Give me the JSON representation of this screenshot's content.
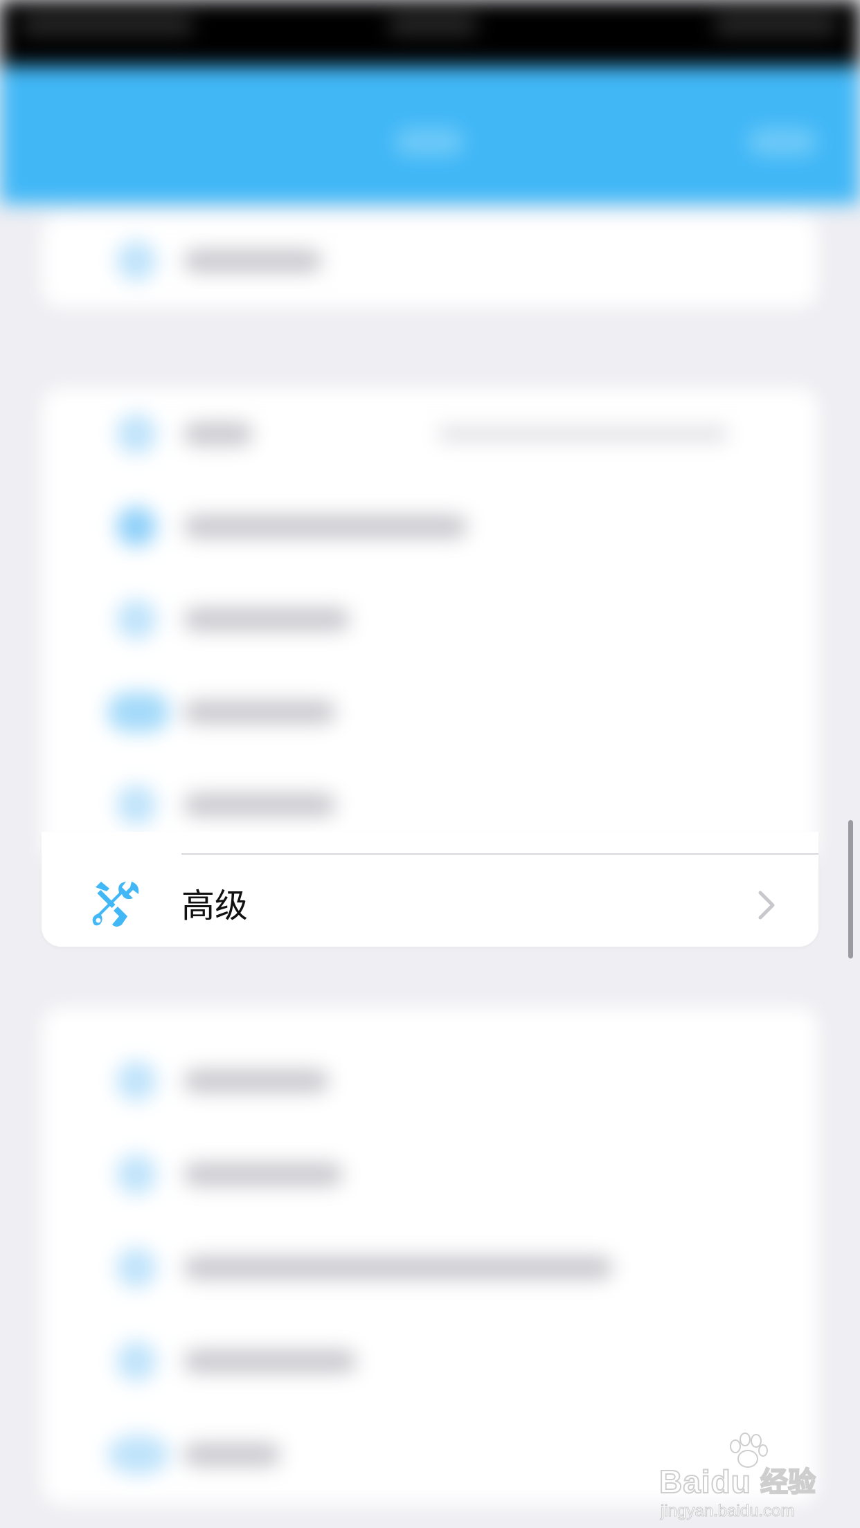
{
  "colors": {
    "accent": "#41b7f6",
    "nav_bar": "#41b7f6",
    "background": "#eeeef3",
    "card": "#ffffff",
    "chevron": "#c7c7cc"
  },
  "advanced_row": {
    "label": "高级",
    "icon": "tools-icon",
    "chevron_icon": "chevron-right-icon"
  },
  "watermark": {
    "brand": "Bai",
    "brand_suffix": "du",
    "brand_cn": "经验",
    "url": "jingyan.baidu.com"
  }
}
